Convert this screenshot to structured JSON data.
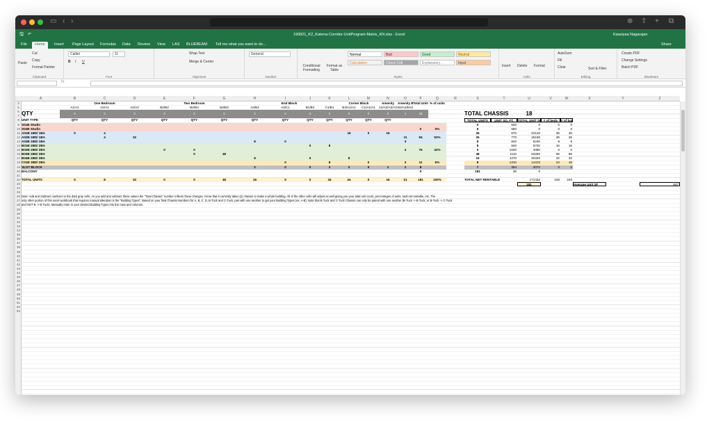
{
  "window": {
    "file_title": "190821_K2_Katerra-Corridor-UnitProgram-Matrix_KN.xlsx - Excel",
    "user": "Kaaviyaa Nagarajan",
    "share": "Share",
    "tell_me": "Tell me what you want to do..."
  },
  "tabs": [
    "File",
    "Home",
    "Insert",
    "Page Layout",
    "Formulas",
    "Data",
    "Review",
    "View",
    "LAS",
    "BLUEBEAM"
  ],
  "ribbon": {
    "clipboard": {
      "paste": "Paste",
      "cut": "Cut",
      "copy": "Copy",
      "format_painter": "Format Painter",
      "label": "Clipboard"
    },
    "font": {
      "name": "Calibri",
      "size": "11",
      "label": "Font"
    },
    "alignment": {
      "wrap": "Wrap Text",
      "merge": "Merge & Center",
      "label": "Alignment"
    },
    "number": {
      "format": "General",
      "label": "Number"
    },
    "styles": {
      "cond": "Conditional Formatting",
      "table": "Format as Table",
      "label": "Styles",
      "boxes": [
        {
          "t": "Normal",
          "bg": "#ffffff",
          "fg": "#000000"
        },
        {
          "t": "Bad",
          "bg": "#ffc7ce",
          "fg": "#9c0006"
        },
        {
          "t": "Good",
          "bg": "#c6efce",
          "fg": "#006100"
        },
        {
          "t": "Neutral",
          "bg": "#ffeb9c",
          "fg": "#9c5700"
        },
        {
          "t": "Calculation",
          "bg": "#f2f2f2",
          "fg": "#fa7d00"
        },
        {
          "t": "Check Cell",
          "bg": "#a5a5a5",
          "fg": "#ffffff"
        },
        {
          "t": "Explanatory ...",
          "bg": "#ffffff",
          "fg": "#7f7f7f"
        },
        {
          "t": "Input",
          "bg": "#ffcc99",
          "fg": "#3f3f76"
        }
      ]
    },
    "cells": {
      "insert": "Insert",
      "delete": "Delete",
      "format": "Format",
      "label": "Cells"
    },
    "editing": {
      "autosum": "AutoSum",
      "fill": "Fill",
      "clear": "Clear",
      "sort": "Sort & Filter",
      "find": "Find & Select",
      "label": "Editing"
    },
    "bluebeam": {
      "create": "Create PDF",
      "change": "Change Settings",
      "batch": "Batch PDF",
      "label": "Bluebeam"
    }
  },
  "formula_bar": {
    "fx": "fx"
  },
  "columns": [
    "A",
    "B",
    "C",
    "D",
    "E",
    "F",
    "G",
    "H",
    "I",
    "J",
    "K",
    "L",
    "M",
    "N",
    "O",
    "P",
    "Q",
    "R",
    "S",
    "T",
    "U",
    "V",
    "W",
    "X",
    "Y",
    "Z"
  ],
  "rows": [
    "4",
    "5",
    "6",
    "7",
    "8",
    "9",
    "10",
    "11",
    "12",
    "13",
    "14",
    "15",
    "16",
    "17",
    "18",
    "19",
    "20",
    "21",
    "22",
    "23",
    "24",
    "25",
    "26",
    "27",
    "28",
    "29",
    "30",
    "31",
    "32",
    "33",
    "34",
    "35",
    "36",
    "37",
    "38",
    "39",
    "40",
    "41",
    "42",
    "43",
    "44",
    "45",
    "46",
    "47",
    "48",
    "49",
    "50",
    "51",
    "52",
    "53"
  ],
  "groups": [
    "One Bedroom",
    "Two Bedroom",
    "End Block",
    "Corner Block",
    "Amenity",
    "Amenity Block",
    "Total Units",
    "% of units"
  ],
  "unit_codes": [
    "A1/A1",
    "A2/A1",
    "A2/A2",
    "B2/B2",
    "B2/B3",
    "B3/B3",
    "A3/B4",
    "A3/C1",
    "B1/B4",
    "C1/B1",
    "B4/A1/A1",
    "C1/A1/A1",
    "A2/A2/A2/A2",
    "B2/A2/EndBlock"
  ],
  "qty_label": "QTY",
  "chassis_nums": [
    "0",
    "0",
    "0",
    "0",
    "0",
    "0",
    "0",
    "0",
    "0",
    "0",
    "0",
    "0",
    "0",
    "1",
    "18"
  ],
  "unit_type_header": "UNIT TYPE",
  "qty_headers": [
    "QTY",
    "QTY",
    "QTY",
    "QTY",
    "QTY",
    "QTY",
    "QTY",
    "QTY",
    "QTY",
    "QTY",
    "QTY",
    "QTY",
    "QTY"
  ],
  "unit_rows": [
    {
      "t": "S01B Studio",
      "v": {
        "B": "",
        "C": "",
        "D": ""
      }
    },
    {
      "t": "S02B Studio",
      "v": {
        "P": "0",
        "Q": "0%"
      }
    },
    {
      "t": "A01B 1BD/ 1BA",
      "v": {
        "B": "0",
        "C": "4",
        "L": "16",
        "M": "0",
        "N": "16"
      }
    },
    {
      "t": "A02B 1BD/ 1BA",
      "v": {
        "C": "4",
        "D": "32",
        "O": "11",
        "P": "94",
        "Q": "52%"
      }
    },
    {
      "t": "A03B 1BD/ 1BA",
      "v": {
        "H": "8",
        "I": "0",
        "O": "3"
      }
    },
    {
      "t": "B01B 2BD/ 2BA",
      "v": {
        "J": "0",
        "K": "8"
      }
    },
    {
      "t": "B02B 2BD/ 2BA",
      "v": {
        "E": "0",
        "F": "0",
        "O": "4",
        "P": "76",
        "Q": "42%"
      }
    },
    {
      "t": "B03B 2BD/ 2BA",
      "v": {
        "F": "0",
        "G": "48"
      }
    },
    {
      "t": "B04B 2BD/ 2BA",
      "v": {
        "H": "8",
        "J": "0",
        "L": "8"
      }
    },
    {
      "t": "C01B 3BD/ 2BA",
      "v": {
        "I": "0",
        "K": "8",
        "M": "0",
        "O": "3",
        "P": "11",
        "Q": "6%"
      }
    },
    {
      "t": "SLOT BLOCK",
      "v": {
        "H": "2",
        "I": "0",
        "J": "0",
        "K": "2",
        "L": "2",
        "M": "0",
        "N": "1",
        "O": "1",
        "P": "8"
      }
    },
    {
      "t": "BALCONY",
      "v": {
        "P": "0"
      }
    }
  ],
  "totals": {
    "label": "TOTAL UNITS",
    "v": [
      "0",
      "8",
      "32",
      "0",
      "0",
      "48",
      "16",
      "0",
      "0",
      "16",
      "24",
      "0",
      "16",
      "21",
      "181",
      "100%"
    ]
  },
  "chassis": {
    "label": "TOTAL CHASSIS",
    "value": "18"
  },
  "right_table": {
    "headers": [
      "TOTAL UNITS",
      "UNIT SQ. FT.",
      "TOTAL UNIT SQ.",
      "# of beds",
      "# of baths"
    ],
    "rows": [
      [
        "0",
        "500",
        "0",
        "0",
        "0"
      ],
      [
        "8",
        "580",
        "0",
        "0",
        "0"
      ],
      [
        "36",
        "670",
        "24120",
        "36",
        "36"
      ],
      [
        "36",
        "770",
        "26190",
        "36",
        "36"
      ],
      [
        "8",
        "840",
        "6240",
        "8",
        "8"
      ],
      [
        "8",
        "840",
        "6720",
        "16",
        "16"
      ],
      [
        "0",
        "1020",
        "4080",
        "0",
        "0"
      ],
      [
        "48",
        "1110",
        "53280",
        "96",
        "96"
      ],
      [
        "16",
        "1270",
        "20320",
        "32",
        "32"
      ],
      [
        "8",
        "1310",
        "14410",
        "24",
        "16"
      ],
      [
        "7",
        "384",
        "3072",
        "0",
        "0"
      ],
      [
        "181",
        "36",
        "0",
        "",
        ""
      ]
    ],
    "net_label": "TOTAL NET RENTABLE",
    "net": [
      "171432",
      "248",
      "240"
    ],
    "avg_units": "181",
    "avg_label": "Average Unit SF",
    "avg_value": "947"
  },
  "notes": [
    "Note: Add and Subtract numbers to the dark gray cells. As you add and subtract these values the \"Total Chassis\" number reflects these changes. Know that it currently takes (2) chassis to make a whole building. All of the other cells will adjust as well giving you your total unit count, percentages of units, total net rentable, etc. The",
    "only other portion of this excel workbook that requires manual alteration is the \"Building Types\". Based on your final Chassis Numbers for A, B, C, D, B-Tuck and C-Tuck, pair with one another to get your Building Types (ex. A-B). Note that B-Tuck and C-Tuck Chassis can only be paired with one another (B-Tuck -> B-Tuck, or B-Tuck -> C-Tuck",
    "and NOT B -> B-Tuck). Manually enter in your desired Building Types into the rows and columns."
  ]
}
